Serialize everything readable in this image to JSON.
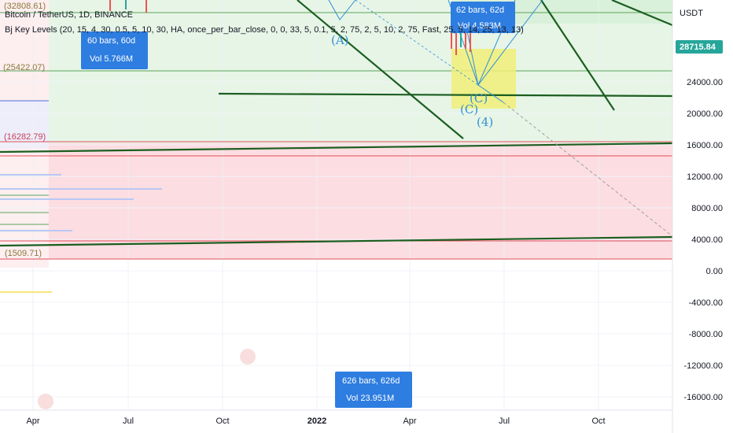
{
  "header": {
    "title": "Bitcoin / TetherUS, 1D, BINANCE",
    "indicator": "Bj Key Levels (20, 15, 4, 30, 0.5, 5, 10, 30, HA, once_per_bar_close, 0, 0, 33, 5, 0.1, 5, 2, 75, 2, 5, 10, 2, 75, Fast, 25, 5, 14, 25, 13, 13)"
  },
  "chart_data": {
    "type": "line",
    "currency": "USDT",
    "current_price": "28715.84",
    "ylim": [
      -18000,
      34000
    ],
    "y_ticks": [
      "24000.00",
      "20000.00",
      "16000.00",
      "12000.00",
      "8000.00",
      "4000.00",
      "0.00",
      "-4000.00",
      "-8000.00",
      "-12000.00",
      "-16000.00"
    ],
    "x_ticks": [
      "Apr",
      "Jul",
      "Oct",
      "2022",
      "Apr",
      "Jul",
      "Oct"
    ],
    "key_levels": [
      "(32808.61)",
      "(25422.07)",
      "(16282.79)",
      "(1509.71)"
    ],
    "wave_labels": [
      "(A)",
      "(C)",
      "(C)",
      "(4)"
    ],
    "measures": [
      {
        "bars": "60 bars, 60d",
        "vol": "Vol 5.766M"
      },
      {
        "bars": "62 bars, 62d",
        "vol": "Vol 4.583M"
      },
      {
        "bars": "626 bars, 626d",
        "vol": "Vol 23.951M"
      }
    ],
    "colors": {
      "bull_zone": "#e6f4e6",
      "bear_zone": "#fddde0",
      "trendline": "#1b5e20",
      "measure_box": "#2e7de0",
      "price_tag": "#26a69a",
      "highlight": "#f2f07a"
    }
  }
}
